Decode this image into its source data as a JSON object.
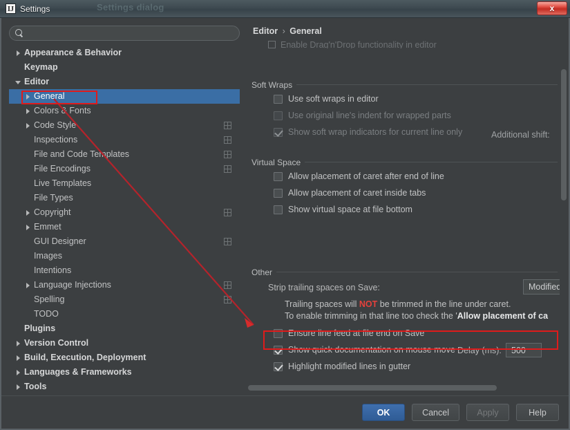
{
  "window": {
    "title": "Settings",
    "logo_text": "IJ",
    "close_label": "x",
    "ghost_text": "Settings dialog"
  },
  "search": {
    "value": "",
    "placeholder": ""
  },
  "sidebar": {
    "items": [
      {
        "label": "Appearance & Behavior",
        "arrow": "right",
        "indent": 0,
        "bold": true,
        "selected": false,
        "cfg": false
      },
      {
        "label": "Keymap",
        "arrow": "none",
        "indent": 0,
        "bold": true,
        "selected": false,
        "cfg": false
      },
      {
        "label": "Editor",
        "arrow": "down",
        "indent": 0,
        "bold": true,
        "selected": false,
        "cfg": false
      },
      {
        "label": "General",
        "arrow": "right",
        "indent": 1,
        "bold": false,
        "selected": true,
        "cfg": false
      },
      {
        "label": "Colors & Fonts",
        "arrow": "right",
        "indent": 1,
        "bold": false,
        "selected": false,
        "cfg": false
      },
      {
        "label": "Code Style",
        "arrow": "right",
        "indent": 1,
        "bold": false,
        "selected": false,
        "cfg": true
      },
      {
        "label": "Inspections",
        "arrow": "none",
        "indent": 1,
        "bold": false,
        "selected": false,
        "cfg": true
      },
      {
        "label": "File and Code Templates",
        "arrow": "none",
        "indent": 1,
        "bold": false,
        "selected": false,
        "cfg": true
      },
      {
        "label": "File Encodings",
        "arrow": "none",
        "indent": 1,
        "bold": false,
        "selected": false,
        "cfg": true
      },
      {
        "label": "Live Templates",
        "arrow": "none",
        "indent": 1,
        "bold": false,
        "selected": false,
        "cfg": false
      },
      {
        "label": "File Types",
        "arrow": "none",
        "indent": 1,
        "bold": false,
        "selected": false,
        "cfg": false
      },
      {
        "label": "Copyright",
        "arrow": "right",
        "indent": 1,
        "bold": false,
        "selected": false,
        "cfg": true
      },
      {
        "label": "Emmet",
        "arrow": "right",
        "indent": 1,
        "bold": false,
        "selected": false,
        "cfg": false
      },
      {
        "label": "GUI Designer",
        "arrow": "none",
        "indent": 1,
        "bold": false,
        "selected": false,
        "cfg": true
      },
      {
        "label": "Images",
        "arrow": "none",
        "indent": 1,
        "bold": false,
        "selected": false,
        "cfg": false
      },
      {
        "label": "Intentions",
        "arrow": "none",
        "indent": 1,
        "bold": false,
        "selected": false,
        "cfg": false
      },
      {
        "label": "Language Injections",
        "arrow": "right",
        "indent": 1,
        "bold": false,
        "selected": false,
        "cfg": true
      },
      {
        "label": "Spelling",
        "arrow": "none",
        "indent": 1,
        "bold": false,
        "selected": false,
        "cfg": true
      },
      {
        "label": "TODO",
        "arrow": "none",
        "indent": 1,
        "bold": false,
        "selected": false,
        "cfg": false
      },
      {
        "label": "Plugins",
        "arrow": "none",
        "indent": 0,
        "bold": true,
        "selected": false,
        "cfg": false
      },
      {
        "label": "Version Control",
        "arrow": "right",
        "indent": 0,
        "bold": true,
        "selected": false,
        "cfg": false
      },
      {
        "label": "Build, Execution, Deployment",
        "arrow": "right",
        "indent": 0,
        "bold": true,
        "selected": false,
        "cfg": false
      },
      {
        "label": "Languages & Frameworks",
        "arrow": "right",
        "indent": 0,
        "bold": true,
        "selected": false,
        "cfg": false
      },
      {
        "label": "Tools",
        "arrow": "right",
        "indent": 0,
        "bold": true,
        "selected": false,
        "cfg": false
      }
    ]
  },
  "breadcrumb": {
    "parent": "Editor",
    "sep": "›",
    "current": "General"
  },
  "content": {
    "partial_top_row": "Enable Drag'n'Drop functionality in editor",
    "groups": [
      {
        "title": "Soft Wraps",
        "rows": [
          {
            "label": "Use soft wraps in editor",
            "checked": false,
            "disabled": false
          },
          {
            "label": "Use original line's indent for wrapped parts",
            "checked": false,
            "disabled": true
          },
          {
            "label": "Show soft wrap indicators for current line only",
            "checked": true,
            "disabled": true
          }
        ],
        "side_label": "Additional shift:"
      },
      {
        "title": "Virtual Space",
        "rows": [
          {
            "label": "Allow placement of caret after end of line",
            "checked": false,
            "disabled": false
          },
          {
            "label": "Allow placement of caret inside tabs",
            "checked": false,
            "disabled": false
          },
          {
            "label": "Show virtual space at file bottom",
            "checked": false,
            "disabled": false
          }
        ]
      }
    ],
    "other": {
      "title": "Other",
      "strip_label": "Strip trailing spaces on Save:",
      "strip_value": "Modified",
      "note_line1_pre": "Trailing spaces will ",
      "note_line1_not": "NOT",
      "note_line1_post": " be trimmed in the line under caret.",
      "note_line2_pre": "To enable trimming in that line too check the '",
      "note_line2_bold": "Allow placement of ca",
      "rows": [
        {
          "label": "Ensure line feed at file end on Save",
          "checked": false
        },
        {
          "label": "Show quick documentation on mouse move",
          "checked": true
        },
        {
          "label": "Highlight modified lines in gutter",
          "checked": true
        }
      ],
      "delay_label": "Delay (ms):",
      "delay_value": "500"
    }
  },
  "buttons": {
    "ok": "OK",
    "cancel": "Cancel",
    "apply": "Apply",
    "help": "Help"
  },
  "colors": {
    "selection_blue": "#3a6ea5",
    "annotation_red": "#e01b1b",
    "error_red": "#e5413c",
    "background": "#3c3f41"
  }
}
